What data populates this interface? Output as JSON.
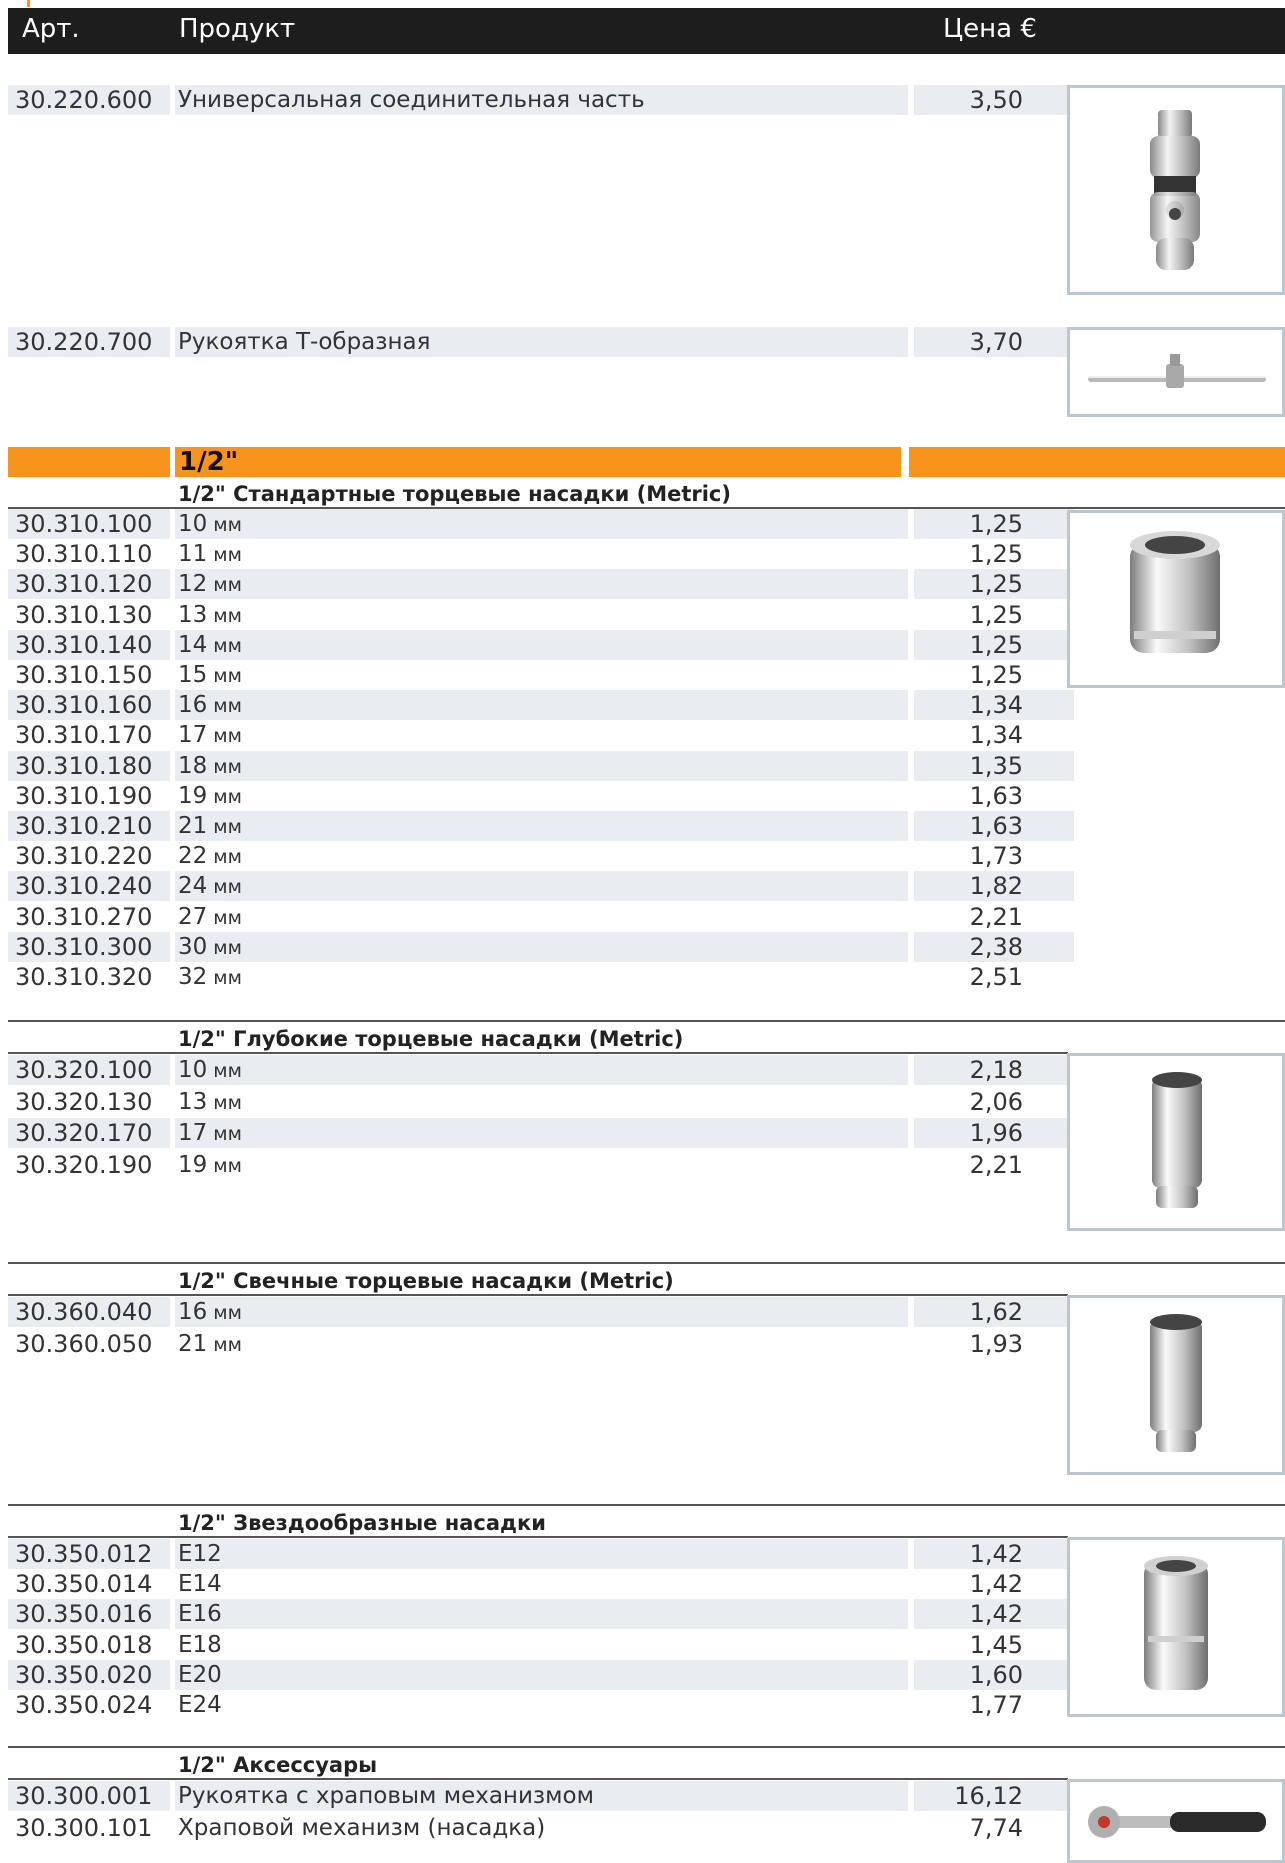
{
  "header": {
    "art": "Арт.",
    "product": "Продукт",
    "price": "Цена €"
  },
  "top_items": [
    {
      "art": "30.220.600",
      "name": "Универсальная соединительная часть",
      "price": "3,50"
    },
    {
      "art": "30.220.700",
      "name": "Рукоятка Т-образная",
      "price": "3,70"
    }
  ],
  "band_label": "1/2\"",
  "sections": [
    {
      "title": "1/2\" Стандартные торцевые насадки (Metric)",
      "items": [
        {
          "art": "30.310.100",
          "size": "10",
          "unit": "мм",
          "price": "1,25"
        },
        {
          "art": "30.310.110",
          "size": "11",
          "unit": "мм",
          "price": "1,25"
        },
        {
          "art": "30.310.120",
          "size": "12",
          "unit": "мм",
          "price": "1,25"
        },
        {
          "art": "30.310.130",
          "size": "13",
          "unit": "мм",
          "price": "1,25"
        },
        {
          "art": "30.310.140",
          "size": "14",
          "unit": "мм",
          "price": "1,25"
        },
        {
          "art": "30.310.150",
          "size": "15",
          "unit": "мм",
          "price": "1,25"
        },
        {
          "art": "30.310.160",
          "size": "16",
          "unit": "мм",
          "price": "1,34"
        },
        {
          "art": "30.310.170",
          "size": "17",
          "unit": "мм",
          "price": "1,34"
        },
        {
          "art": "30.310.180",
          "size": "18",
          "unit": "мм",
          "price": "1,35"
        },
        {
          "art": "30.310.190",
          "size": "19",
          "unit": "мм",
          "price": "1,63"
        },
        {
          "art": "30.310.210",
          "size": "21",
          "unit": "мм",
          "price": "1,63"
        },
        {
          "art": "30.310.220",
          "size": "22",
          "unit": "мм",
          "price": "1,73"
        },
        {
          "art": "30.310.240",
          "size": "24",
          "unit": "мм",
          "price": "1,82"
        },
        {
          "art": "30.310.270",
          "size": "27",
          "unit": "мм",
          "price": "2,21"
        },
        {
          "art": "30.310.300",
          "size": "30",
          "unit": "мм",
          "price": "2,38"
        },
        {
          "art": "30.310.320",
          "size": "32",
          "unit": "мм",
          "price": "2,51"
        }
      ]
    },
    {
      "title": "1/2\" Глубокие торцевые насадки (Metric)",
      "items": [
        {
          "art": "30.320.100",
          "size": "10",
          "unit": "мм",
          "price": "2,18"
        },
        {
          "art": "30.320.130",
          "size": "13",
          "unit": "мм",
          "price": "2,06"
        },
        {
          "art": "30.320.170",
          "size": "17",
          "unit": "мм",
          "price": "1,96"
        },
        {
          "art": "30.320.190",
          "size": "19",
          "unit": "мм",
          "price": "2,21"
        }
      ]
    },
    {
      "title": "1/2\" Свечные торцевые насадки (Metric)",
      "items": [
        {
          "art": "30.360.040",
          "size": "16",
          "unit": "мм",
          "price": "1,62"
        },
        {
          "art": "30.360.050",
          "size": "21",
          "unit": "мм",
          "price": "1,93"
        }
      ]
    },
    {
      "title": "1/2\" Звездообразные насадки",
      "items": [
        {
          "art": "30.350.012",
          "size": "E12",
          "unit": "",
          "price": "1,42"
        },
        {
          "art": "30.350.014",
          "size": "E14",
          "unit": "",
          "price": "1,42"
        },
        {
          "art": "30.350.016",
          "size": "E16",
          "unit": "",
          "price": "1,42"
        },
        {
          "art": "30.350.018",
          "size": "E18",
          "unit": "",
          "price": "1,45"
        },
        {
          "art": "30.350.020",
          "size": "E20",
          "unit": "",
          "price": "1,60"
        },
        {
          "art": "30.350.024",
          "size": "E24",
          "unit": "",
          "price": "1,77"
        }
      ]
    },
    {
      "title": "1/2\" Аксессуары",
      "items": [
        {
          "art": "30.300.001",
          "size": "Рукоятка с храповым механизмом",
          "unit": "",
          "price": "16,12"
        },
        {
          "art": "30.300.101",
          "size": "Храповой механизм (насадка)",
          "unit": "",
          "price": "7,74"
        }
      ]
    }
  ],
  "colors": {
    "header_bg": "#1d1d1d",
    "accent": "#f7941d",
    "row_shade": "#e9edf1",
    "photo_border": "#bcc6cf"
  }
}
